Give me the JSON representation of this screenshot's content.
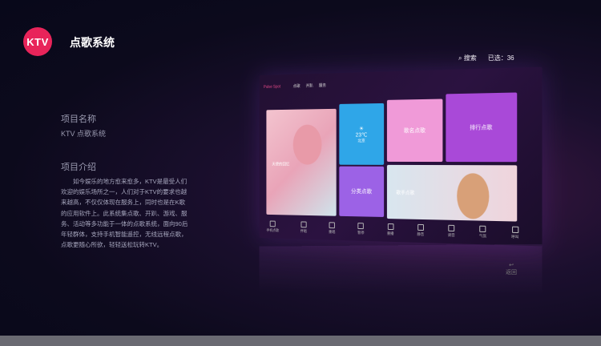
{
  "header": {
    "logo_text": "KTV",
    "title": "点歌系统"
  },
  "project_name": {
    "label": "项目名称",
    "value": "KTV 点歌系统"
  },
  "project_intro": {
    "label": "项目介绍",
    "text": "如今娱乐的地方愈来愈多，KTV是最受人们欢迎的娱乐场所之一，人们对于KTV的要求也越来越高，不仅仅体现在服务上，同时也是在K歌的应用软件上。此系统集点歌、开趴、游戏、服务、活动等多功能于一体的点歌系统，面向90后年轻群体，支持手机智能遥控，无线远程点歌，点歌更随心所欲，轻轻送松玩转KTV。"
  },
  "tv": {
    "top_right": {
      "search": "搜索",
      "selected": "已选：36"
    },
    "brand": "Pulse Spot",
    "tabs": [
      "点歌",
      "开趴",
      "服务"
    ],
    "tiles": {
      "hero_label": "天使的回忆",
      "weather_temp": "23℃",
      "weather_city": "北京",
      "song_search": "歌名点歌",
      "ranking": "排行点歌",
      "category": "分类点歌",
      "singer": "歌手点歌"
    },
    "controls": [
      "手机点歌",
      "伴唱",
      "重唱",
      "暂停",
      "重播",
      "静音",
      "调音",
      "气氛",
      "呼叫"
    ],
    "back": "返回"
  }
}
